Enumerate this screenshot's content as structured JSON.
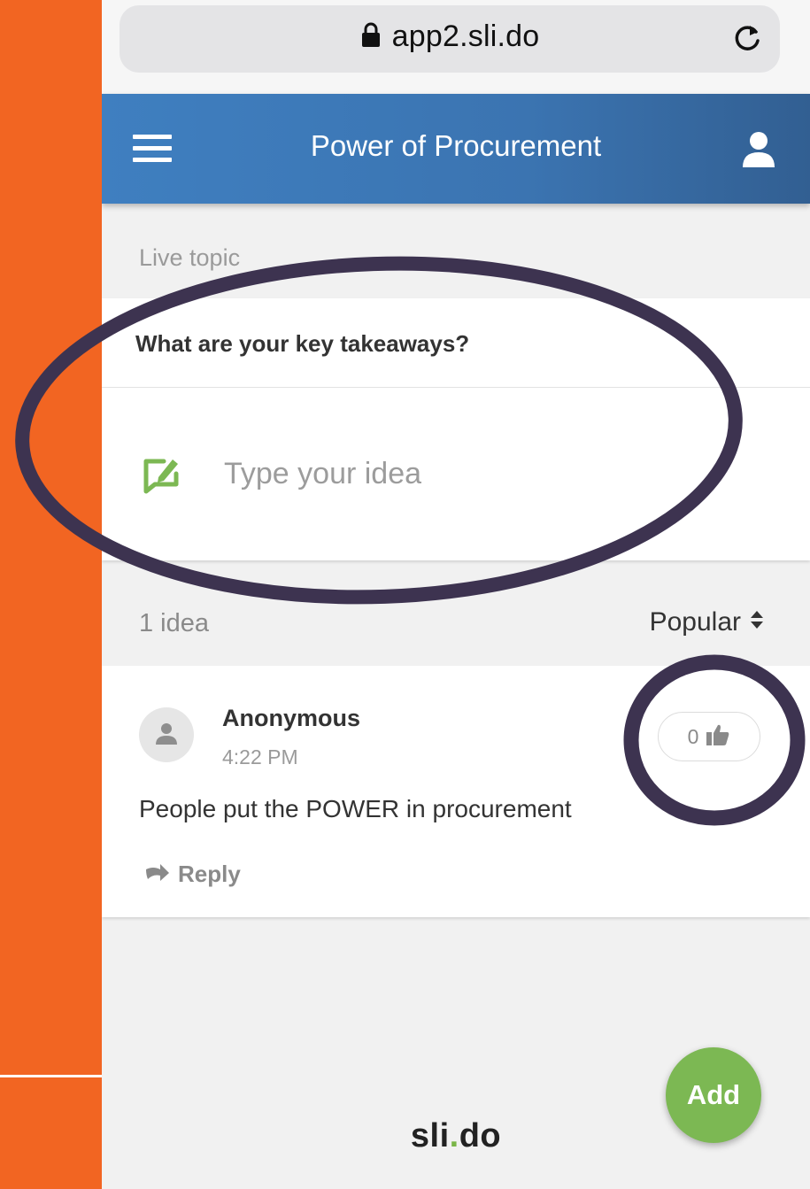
{
  "browser": {
    "url": "app2.sli.do"
  },
  "header": {
    "title": "Power of Procurement"
  },
  "topic": {
    "label": "Live topic",
    "question": "What are your key takeaways?",
    "input_placeholder": "Type your idea"
  },
  "ideas": {
    "count_label": "1 idea",
    "sort_label": "Popular",
    "items": [
      {
        "author": "Anonymous",
        "time": "4:22 PM",
        "text": "People put the POWER in procurement",
        "likes": "0",
        "reply_label": "Reply"
      }
    ]
  },
  "footer": {
    "logo_prefix": "sli",
    "logo_dot": ".",
    "logo_suffix": "do"
  },
  "fab": {
    "label": "Add"
  },
  "colors": {
    "page_background": "#f26522",
    "header_blue": "#3b74b1",
    "accent_green": "#7cb853",
    "annotation": "#3d3350"
  }
}
